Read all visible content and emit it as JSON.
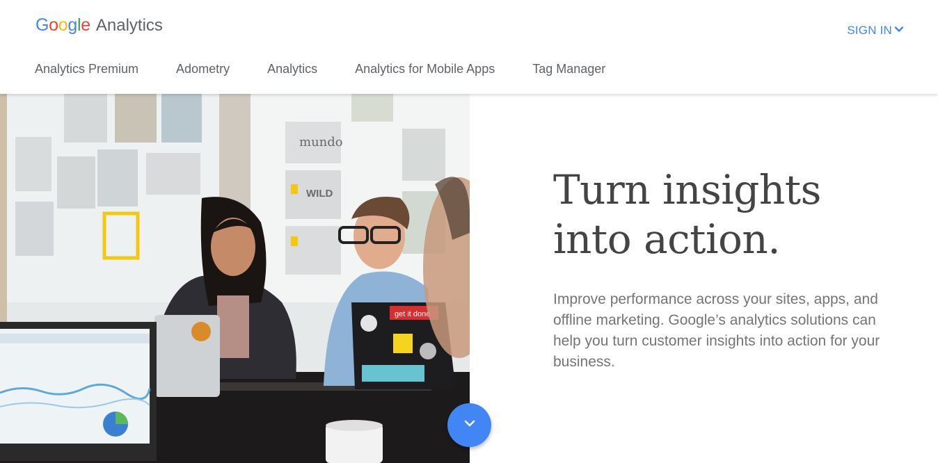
{
  "brand": {
    "logo_letters": [
      {
        "char": "G",
        "color": "#4285F4"
      },
      {
        "char": "o",
        "color": "#EA4335"
      },
      {
        "char": "o",
        "color": "#FBBC05"
      },
      {
        "char": "g",
        "color": "#4285F4"
      },
      {
        "char": "l",
        "color": "#34A853"
      },
      {
        "char": "e",
        "color": "#EA4335"
      }
    ],
    "product": "Analytics"
  },
  "header": {
    "signin_label": "SIGN IN",
    "signin_icon": "chevron-down-icon",
    "accent_color": "#4285F4"
  },
  "nav": {
    "items": [
      {
        "label": "Analytics Premium"
      },
      {
        "label": "Adometry"
      },
      {
        "label": "Analytics"
      },
      {
        "label": "Analytics for Mobile Apps"
      },
      {
        "label": "Tag Manager"
      }
    ]
  },
  "hero": {
    "title_line1": "Turn insights",
    "title_line2": "into action.",
    "subtitle": "Improve performance across your sites, apps, and offline marketing. Google’s analytics solutions can help you turn customer insights into action for your business.",
    "image_wall_labels": [
      "mundo",
      "WILD",
      "get it done"
    ],
    "scroll_icon": "chevron-down-icon"
  }
}
